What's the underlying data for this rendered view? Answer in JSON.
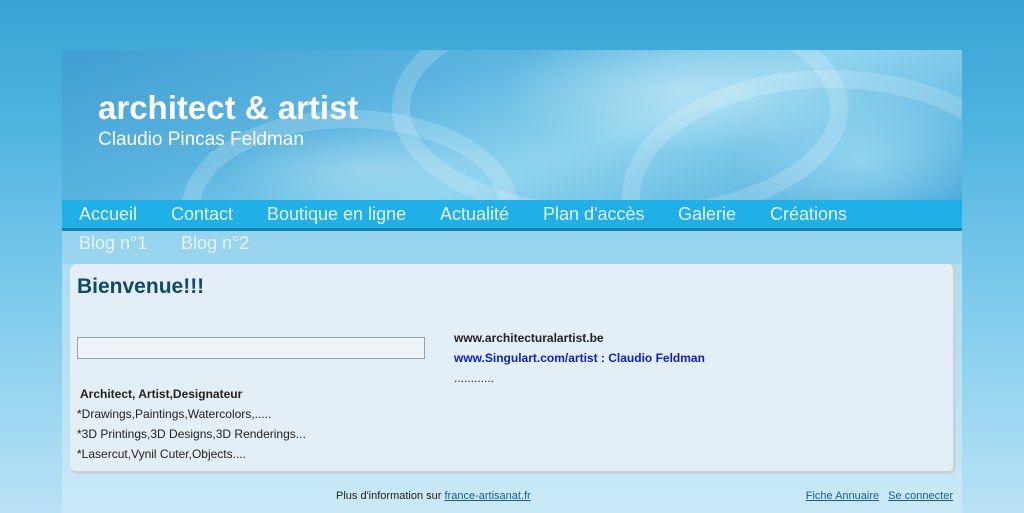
{
  "header": {
    "title": "architect & artist",
    "subtitle": "Claudio Pincas Feldman"
  },
  "nav": {
    "items": [
      "Accueil",
      "Contact",
      "Boutique en ligne",
      "Actualité",
      "Plan d'accès",
      "Galerie",
      "Créations"
    ],
    "items_row2": [
      "Blog n°1",
      "Blog n°2"
    ]
  },
  "main": {
    "heading": "Bienvenue!!!",
    "search_value": "",
    "left_lines": [
      "Architect, Artist,Designateur",
      "*Drawings,Paintings,Watercolors,.....",
      "*3D Printings,3D Designs,3D Renderings...",
      "*Lasercut,Vynil Cuter,Objects...."
    ],
    "right_lines": [
      "www.architecturalartist.be",
      "www.Singulart.com/artist : Claudio Feldman",
      "............"
    ]
  },
  "footer": {
    "info_prefix": "Plus d'information sur",
    "info_link": "france-artisanat.fr",
    "directory_link": "Fiche Annuaire",
    "login_link": "Se connecter"
  },
  "colors": {
    "nav_bar": "#1eb0e6",
    "title_text": "#ffffff",
    "heading": "#0f4a6a",
    "link_blue": "#0a1ed6"
  }
}
